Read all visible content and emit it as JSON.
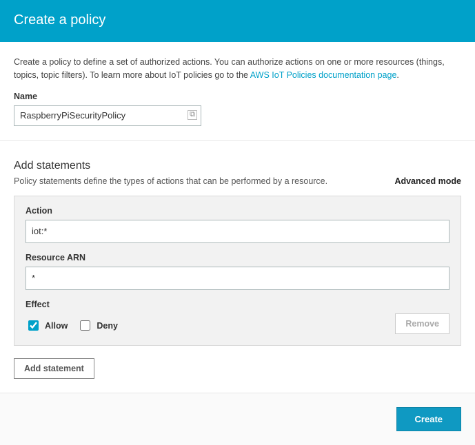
{
  "header": {
    "title": "Create a policy"
  },
  "intro": {
    "text_before": "Create a policy to define a set of authorized actions. You can authorize actions on one or more resources (things, topics, topic filters). To learn more about IoT policies go to the ",
    "link_text": "AWS IoT Policies documentation page",
    "text_after": "."
  },
  "name": {
    "label": "Name",
    "value": "RaspberryPiSecurityPolicy"
  },
  "statements": {
    "heading": "Add statements",
    "subdesc": "Policy statements define the types of actions that can be performed by a resource.",
    "advanced_label": "Advanced mode",
    "action_label": "Action",
    "action_value": "iot:*",
    "resource_label": "Resource ARN",
    "resource_value": "*",
    "effect_label": "Effect",
    "allow_label": "Allow",
    "deny_label": "Deny",
    "allow_checked": true,
    "deny_checked": false,
    "remove_label": "Remove",
    "add_label": "Add statement"
  },
  "footer": {
    "create_label": "Create"
  }
}
